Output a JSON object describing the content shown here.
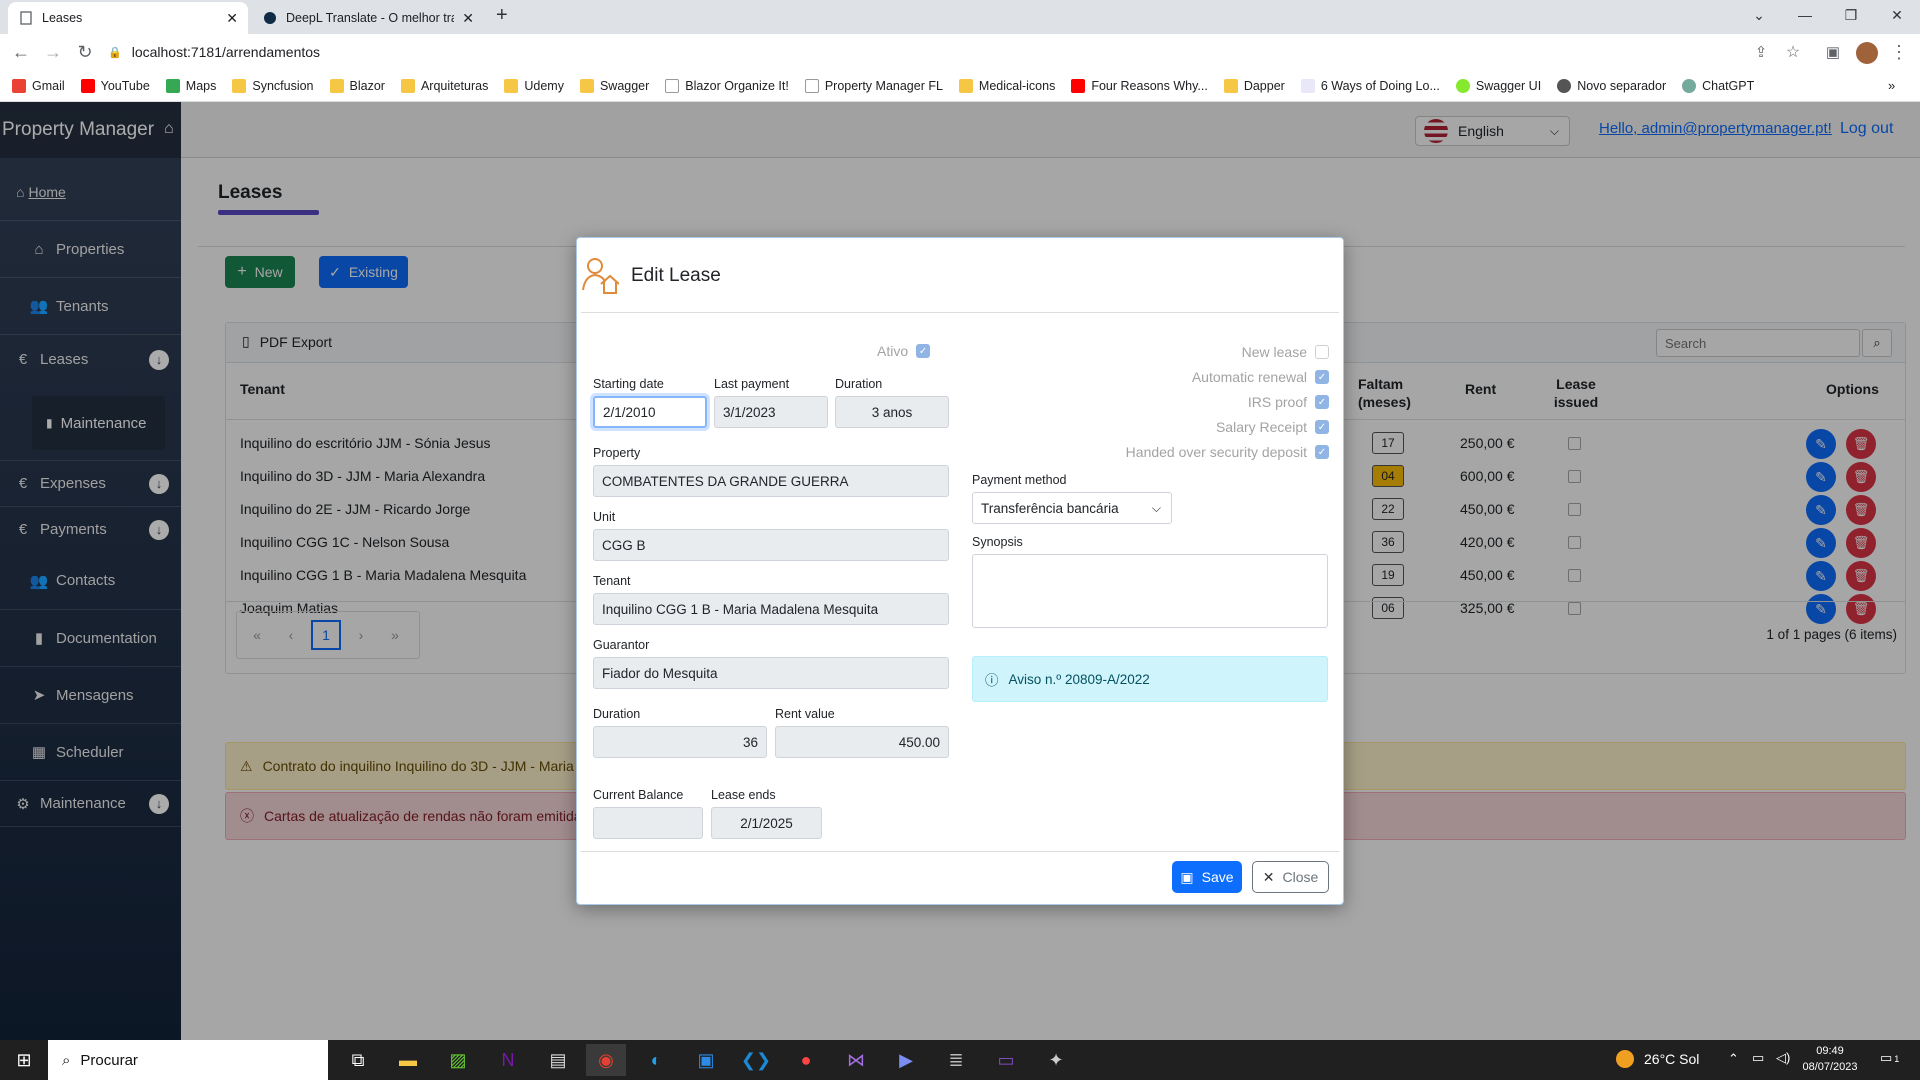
{
  "browser": {
    "tabs": [
      {
        "title": "Leases"
      },
      {
        "title": "DeepL Translate - O melhor tradutor"
      }
    ],
    "new_tab": "+",
    "url": "localhost:7181/arrendamentos",
    "bookmarks": [
      "Gmail",
      "YouTube",
      "Maps",
      "Syncfusion",
      "Blazor",
      "Arquiteturas",
      "Udemy",
      "Swagger",
      "Blazor Organize It!",
      "Property Manager FL",
      "Medical-icons",
      "Four Reasons Why...",
      "Dapper",
      "6 Ways of Doing Lo...",
      "Swagger UI",
      "Novo separador",
      "ChatGPT"
    ]
  },
  "app": {
    "brand": "Property Manager",
    "language": "English",
    "greeting": "Hello, admin@propertymanager.pt!",
    "logout": "Log out",
    "sidebar": [
      {
        "label": "Home",
        "icon": "home-icon"
      },
      {
        "label": "Properties",
        "icon": "home-icon"
      },
      {
        "label": "Tenants",
        "icon": "users-icon"
      },
      {
        "label": "Leases",
        "icon": "euro-icon"
      },
      {
        "label": "Maintenance",
        "icon": "file-icon"
      },
      {
        "label": "Expenses",
        "icon": "euro-icon"
      },
      {
        "label": "Payments",
        "icon": "euro-icon"
      },
      {
        "label": "Contacts",
        "icon": "users-icon"
      },
      {
        "label": "Documentation",
        "icon": "file-icon"
      },
      {
        "label": "Mensagens",
        "icon": "send-icon"
      },
      {
        "label": "Scheduler",
        "icon": "calendar-icon"
      },
      {
        "label": "Maintenance",
        "icon": "gear-icon"
      }
    ],
    "page_title": "Leases",
    "btn_new": "New",
    "btn_existing": "Existing",
    "pdf_export": "PDF Export",
    "search_placeholder": "Search",
    "columns": {
      "tenant": "Tenant",
      "faltam": "Faltam (meses)",
      "rent": "Rent",
      "issued": "Lease issued",
      "options": "Options"
    },
    "rows": [
      {
        "tenant": "Inquilino do escritório JJM - Sónia Jesus",
        "faltam": "17",
        "rent": "250,00 €",
        "warn": false
      },
      {
        "tenant": "Inquilino do 3D - JJM - Maria Alexandra",
        "faltam": "04",
        "rent": "600,00 €",
        "warn": true
      },
      {
        "tenant": "Inquilino do 2E - JJM - Ricardo Jorge",
        "faltam": "22",
        "rent": "450,00 €",
        "warn": false
      },
      {
        "tenant": "Inquilino CGG 1C - Nelson Sousa",
        "faltam": "36",
        "rent": "420,00 €",
        "warn": false
      },
      {
        "tenant": "Inquilino CGG 1 B - Maria Madalena Mesquita",
        "faltam": "19",
        "rent": "450,00 €",
        "warn": false
      },
      {
        "tenant": "Joaquim Matias",
        "faltam": "06",
        "rent": "325,00 €",
        "warn": false
      }
    ],
    "pager": {
      "first": "«",
      "prev": "‹",
      "page": "1",
      "next": "›",
      "last": "»",
      "summary": "1 of 1 pages (6 items)"
    },
    "alert_warning": "Contrato do inquilino Inquilino do 3D - JJM - Maria",
    "alert_danger": "Cartas de atualização de rendas não foram emitida"
  },
  "modal": {
    "title": "Edit Lease",
    "ativo_label": "Ativo",
    "checks": [
      {
        "label": "New lease",
        "checked": false
      },
      {
        "label": "Automatic renewal",
        "checked": true
      },
      {
        "label": "IRS proof",
        "checked": true
      },
      {
        "label": "Salary Receipt",
        "checked": true
      },
      {
        "label": "Handed over security deposit",
        "checked": true
      }
    ],
    "starting_date_label": "Starting date",
    "starting_date": "2/1/2010",
    "last_payment_label": "Last payment",
    "last_payment": "3/1/2023",
    "duration_label": "Duration",
    "duration_text": "3 anos",
    "property_label": "Property",
    "property": "COMBATENTES DA GRANDE GUERRA",
    "unit_label": "Unit",
    "unit": "CGG B",
    "tenant_label": "Tenant",
    "tenant": "Inquilino CGG 1 B - Maria Madalena Mesquita",
    "guarantor_label": "Guarantor",
    "guarantor": "Fiador do Mesquita",
    "duration2_label": "Duration",
    "duration2": "36",
    "rent_label": "Rent value",
    "rent": "450.00",
    "balance_label": "Current Balance",
    "balance": "",
    "lease_ends_label": "Lease ends",
    "lease_ends": "2/1/2025",
    "payment_method_label": "Payment method",
    "payment_method": "Transferência bancária",
    "synopsis_label": "Synopsis",
    "synopsis": "",
    "info": "Aviso n.º 20809-A/2022",
    "save": "Save",
    "close": "Close"
  },
  "taskbar": {
    "search": "Procurar",
    "weather": "26°C  Sol",
    "time": "09:49",
    "date": "08/07/2023",
    "notif": "1"
  },
  "colors": {
    "primary": "#0d6efd",
    "success": "#198754",
    "danger": "#dc3545",
    "warning": "#ffc107",
    "accent": "#5a49c6"
  }
}
